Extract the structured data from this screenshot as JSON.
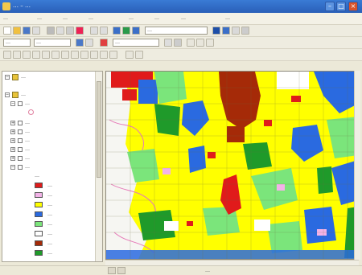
{
  "window": {
    "title": "… – …",
    "controls": {
      "minimize": "–",
      "maximize": "□",
      "close": "×"
    }
  },
  "menu": [
    "…",
    "…",
    "…",
    "…",
    "…",
    "…",
    "…",
    "…"
  ],
  "toolbar_standard": {
    "scale_field": "…"
  },
  "toolbar_editor": {
    "field_1": "…",
    "field_2": "…",
    "field_3": "…"
  },
  "toc": {
    "group_1": "…",
    "group_2": "…",
    "group_3": "…",
    "sublayers": [
      "…",
      "…",
      "…",
      "…",
      "…",
      "…"
    ],
    "legend_heading": "…",
    "legend": [
      {
        "label": "…",
        "color": "#e01b1b"
      },
      {
        "label": "…",
        "color": "#f3b3e8"
      },
      {
        "label": "…",
        "color": "#ffff00"
      },
      {
        "label": "…",
        "color": "#2a6ae0"
      },
      {
        "label": "…",
        "color": "#7be57b"
      },
      {
        "label": "…",
        "color": "#ffffff"
      },
      {
        "label": "…",
        "color": "#a52a08"
      },
      {
        "label": "…",
        "color": "#1f9a2a"
      }
    ]
  },
  "status": {
    "coordinates": "…"
  },
  "colors": {
    "residential": "#ffff00",
    "commercial": "#e01b1b",
    "water": "#2a6ae0",
    "green": "#7be57b",
    "forest": "#1f9a2a",
    "industrial": "#a52a08",
    "public": "#f3b3e8"
  }
}
